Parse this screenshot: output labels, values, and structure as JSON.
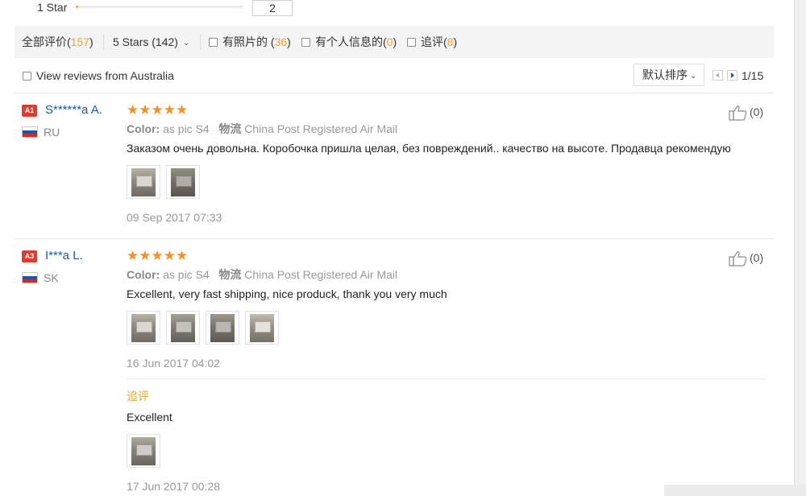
{
  "histogram": {
    "label": "1 Star",
    "fill_fraction": 0.01,
    "count": "2"
  },
  "filters": {
    "all": {
      "label": "全部评价",
      "count": "157"
    },
    "stars": {
      "label": "5 Stars (142)"
    },
    "photos": {
      "label": "有照片的",
      "count": "36"
    },
    "personal": {
      "label": "有个人信息的",
      "count": "0"
    },
    "followup": {
      "label": "追评",
      "count": "8"
    }
  },
  "view_country": {
    "label": "View reviews from Australia"
  },
  "sort": {
    "label": "默认排序"
  },
  "pagination": {
    "text": "1/15"
  },
  "reviews": [
    {
      "badge": "A1",
      "name": "S******a A.",
      "country": "RU",
      "flag_colors": [
        "#ffffff",
        "#1c57a5",
        "#d52b1e"
      ],
      "stars": "★★★★★",
      "color_label": "Color:",
      "color_value": "as pic S4",
      "logistics_label": "物流",
      "logistics_value": "China Post Registered Air Mail",
      "text": "Заказом очень довольна. Коробочка пришла целая, без повреждений.. качество на высоте. Продавца рекомендую",
      "date": "09 Sep 2017 07:33",
      "likes": "(0)",
      "images": 2
    },
    {
      "badge": "A3",
      "name": "I***a L.",
      "country": "SK",
      "flag_colors": [
        "#ffffff",
        "#1c57a5",
        "#d52b1e"
      ],
      "stars": "★★★★★",
      "color_label": "Color:",
      "color_value": "as pic S4",
      "logistics_label": "物流",
      "logistics_value": "China Post Registered Air Mail",
      "text": "Excellent, very fast shipping, nice produck, thank you very much",
      "date": "16 Jun 2017 04:02",
      "likes": "(0)",
      "images": 4,
      "followup": {
        "title": "追评",
        "text": "Excellent",
        "date": "17 Jun 2017 00:28",
        "images": 1
      }
    }
  ]
}
